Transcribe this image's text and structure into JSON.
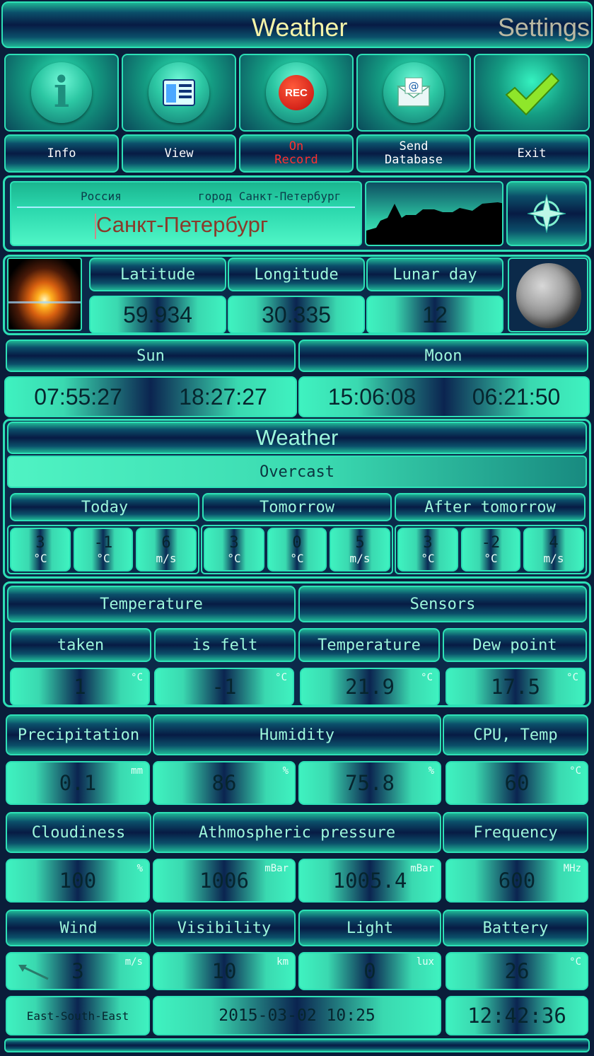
{
  "header": {
    "title": "Weather",
    "settings": "Settings"
  },
  "toolbar": [
    {
      "label": "Info",
      "icon": "info-icon"
    },
    {
      "label": "View",
      "icon": "view-icon"
    },
    {
      "label": "On Record",
      "icon": "rec-icon",
      "rec_text": "REC",
      "color": "#ff3030"
    },
    {
      "label": "Send Database",
      "icon": "email-icon"
    },
    {
      "label": "Exit",
      "icon": "checkmark-icon"
    }
  ],
  "location": {
    "country": "Россия",
    "region": "город Санкт-Петербург",
    "city": "Санкт-Петербург"
  },
  "coords": {
    "latitude_label": "Latitude",
    "longitude_label": "Longitude",
    "lunar_label": "Lunar day",
    "latitude": "59.934",
    "longitude": "30.335",
    "lunar_day": "12"
  },
  "sunmoon": {
    "sun_label": "Sun",
    "moon_label": "Moon",
    "sunrise": "07:55:27",
    "sunset": "18:27:27",
    "moonrise": "15:06:08",
    "moonset": "06:21:50"
  },
  "weather": {
    "title": "Weather",
    "condition": "Overcast",
    "days": [
      {
        "label": "Today",
        "vals": [
          {
            "v": "3",
            "u": "°C"
          },
          {
            "v": "-1",
            "u": "°C"
          },
          {
            "v": "6",
            "u": "m/s"
          }
        ]
      },
      {
        "label": "Tomorrow",
        "vals": [
          {
            "v": "3",
            "u": "°C"
          },
          {
            "v": "0",
            "u": "°C"
          },
          {
            "v": "5",
            "u": "m/s"
          }
        ]
      },
      {
        "label": "After tomorrow",
        "vals": [
          {
            "v": "3",
            "u": "°C"
          },
          {
            "v": "-2",
            "u": "°C"
          },
          {
            "v": "4",
            "u": "m/s"
          }
        ]
      }
    ]
  },
  "temps": {
    "temperature_label": "Temperature",
    "sensors_label": "Sensors",
    "taken_label": "taken",
    "felt_label": "is felt",
    "sensor_temp_label": "Temperature",
    "dew_label": "Dew point",
    "taken": "1",
    "felt": "-1",
    "sensor_temp": "21.9",
    "dew": "17.5",
    "unit_c": "°C"
  },
  "row1": {
    "precip_label": "Precipitation",
    "humidity_label": "Humidity",
    "cpu_label": "CPU, Temp",
    "precip": "0.1",
    "precip_unit": "mm",
    "hum1": "86",
    "hum1_unit": "%",
    "hum2": "75.8",
    "hum2_unit": "%",
    "cpu": "60",
    "cpu_unit": "°C"
  },
  "row2": {
    "cloud_label": "Cloudiness",
    "pressure_label": "Athmospheric pressure",
    "freq_label": "Frequency",
    "cloud": "100",
    "cloud_unit": "%",
    "p1": "1006",
    "p1_unit": "mBar",
    "p2": "1005.4",
    "p2_unit": "mBar",
    "freq": "600",
    "freq_unit": "MHz"
  },
  "row3": {
    "wind_label": "Wind",
    "vis_label": "Visibility",
    "light_label": "Light",
    "battery_label": "Battery",
    "wind": "3",
    "wind_unit": "m/s",
    "vis": "10",
    "vis_unit": "km",
    "light": "0",
    "light_unit": "lux",
    "battery": "26",
    "battery_unit": "°C"
  },
  "footer": {
    "direction": "East-South-East",
    "datetime": "2015-03-02 10:25",
    "clock": "12:42:36"
  }
}
